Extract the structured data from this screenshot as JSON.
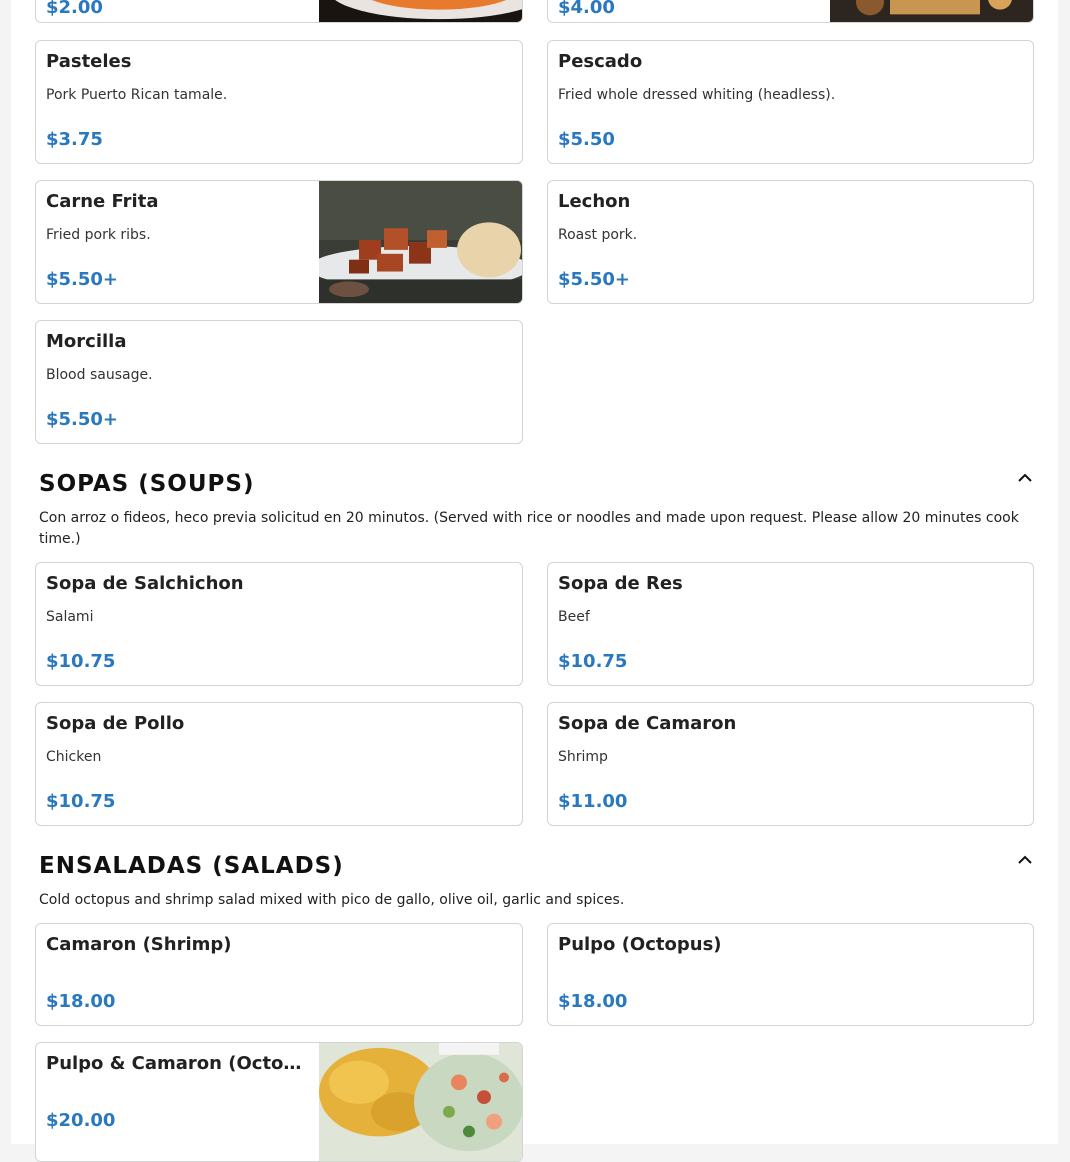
{
  "colors": {
    "price": "#2a78bd",
    "card_border": "#d4d4d4",
    "title": "#111111"
  },
  "partial_top": {
    "left_price": "$2.00",
    "right_price": "$4.00"
  },
  "sides": [
    {
      "name": "Pasteles",
      "description": "Pork Puerto Rican tamale.",
      "price": "$3.75"
    },
    {
      "name": "Pescado",
      "description": "Fried whole dressed whiting (headless).",
      "price": "$5.50"
    },
    {
      "name": "Carne Frita",
      "description": "Fried pork ribs.",
      "price": "$5.50+",
      "image": "fried-pork-ribs-photo"
    },
    {
      "name": "Lechon",
      "description": "Roast pork.",
      "price": "$5.50+"
    },
    {
      "name": "Morcilla",
      "description": "Blood sausage.",
      "price": "$5.50+"
    }
  ],
  "soups": {
    "title": "SOPAS (SOUPS)",
    "description": "Con arroz o fideos, heco previa solicitud en 20 minutos. (Served with rice or noodles and made upon request. Please allow 20 minutes cook time.)",
    "toggle_icon": "chevron-up-icon",
    "items": [
      {
        "name": "Sopa de Salchichon",
        "description": "Salami",
        "price": "$10.75"
      },
      {
        "name": "Sopa de Res",
        "description": "Beef",
        "price": "$10.75"
      },
      {
        "name": "Sopa de Pollo",
        "description": "Chicken",
        "price": "$10.75"
      },
      {
        "name": "Sopa de Camaron",
        "description": "Shrimp",
        "price": "$11.00"
      }
    ]
  },
  "salads": {
    "title": "ENSALADAS (SALADS)",
    "description": "Cold octopus and shrimp salad mixed with pico de gallo, olive oil, garlic and spices.",
    "toggle_icon": "chevron-up-icon",
    "items": [
      {
        "name": "Camaron (Shrimp)",
        "price": "$18.00"
      },
      {
        "name": "Pulpo (Octopus)",
        "price": "$18.00"
      },
      {
        "name": "Pulpo & Camaron (Octopu…",
        "price": "$20.00",
        "image": "seafood-salad-photo"
      }
    ]
  }
}
